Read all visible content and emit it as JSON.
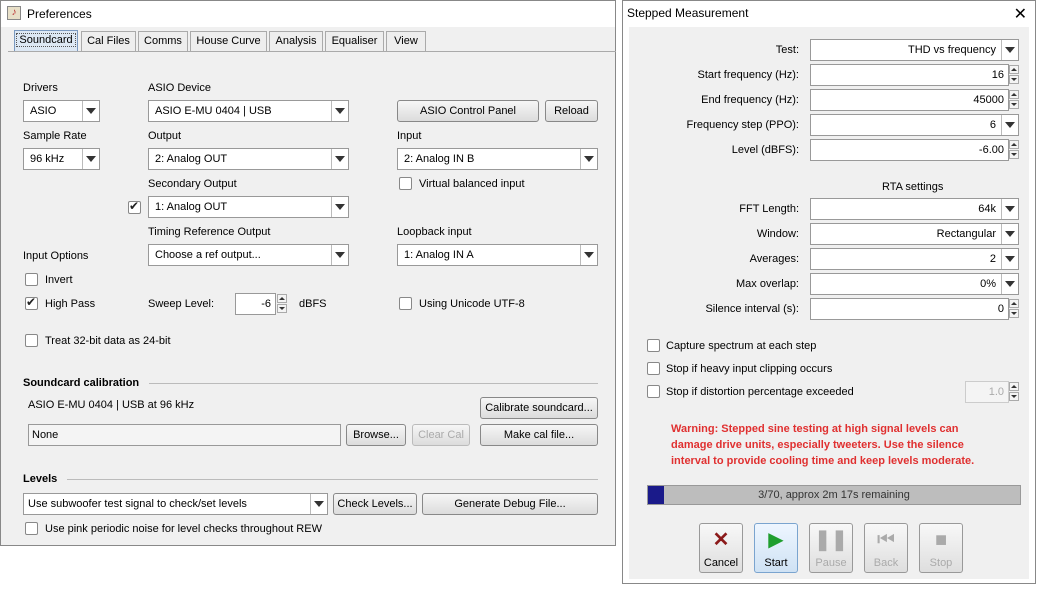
{
  "preferences": {
    "title": "Preferences",
    "tabs": [
      "Soundcard",
      "Cal Files",
      "Comms",
      "House Curve",
      "Analysis",
      "Equaliser",
      "View"
    ],
    "drivers": {
      "label": "Drivers",
      "value": "ASIO"
    },
    "asio_device": {
      "label": "ASIO Device",
      "value": "ASIO E-MU 0404 | USB"
    },
    "asio_control_panel": "ASIO Control Panel",
    "reload": "Reload",
    "sample_rate": {
      "label": "Sample Rate",
      "value": "96 kHz"
    },
    "output": {
      "label": "Output",
      "value": "2: Analog OUT"
    },
    "input": {
      "label": "Input",
      "value": "2: Analog IN B"
    },
    "secondary_output": {
      "label": "Secondary Output",
      "value": "1: Analog OUT",
      "checked": true
    },
    "virtual_balanced": {
      "label": "Virtual balanced input",
      "checked": false
    },
    "timing_ref": {
      "label": "Timing Reference Output",
      "value": "Choose a ref output..."
    },
    "loopback": {
      "label": "Loopback input",
      "value": "1: Analog IN A"
    },
    "input_options": "Input Options",
    "invert": {
      "label": "Invert",
      "checked": false
    },
    "high_pass": {
      "label": "High Pass",
      "checked": true
    },
    "sweep_level": {
      "label": "Sweep Level:",
      "value": "-6",
      "unit": "dBFS"
    },
    "unicode": {
      "label": "Using Unicode UTF-8",
      "checked": false
    },
    "treat_32bit": {
      "label": "Treat 32-bit data as 24-bit",
      "checked": false
    },
    "calibration": {
      "heading": "Soundcard calibration",
      "info": "ASIO E-MU 0404 | USB at 96 kHz",
      "calibrate_btn": "Calibrate soundcard...",
      "file_value": "None",
      "browse_btn": "Browse...",
      "clear_btn": "Clear Cal",
      "make_btn": "Make cal file..."
    },
    "levels": {
      "heading": "Levels",
      "signal_value": "Use subwoofer test signal to check/set levels",
      "check_btn": "Check Levels...",
      "debug_btn": "Generate Debug File...",
      "pink_noise": {
        "label": "Use pink periodic noise for level checks throughout REW",
        "checked": false
      }
    }
  },
  "stepped": {
    "title": "Stepped Measurement",
    "fields": [
      {
        "label": "Test:",
        "value": "THD vs frequency",
        "kind": "combo"
      },
      {
        "label": "Start frequency (Hz):",
        "value": "16",
        "kind": "spin"
      },
      {
        "label": "End frequency (Hz):",
        "value": "45000",
        "kind": "spin"
      },
      {
        "label": "Frequency step (PPO):",
        "value": "6",
        "kind": "combo"
      },
      {
        "label": "Level (dBFS):",
        "value": "-6.00",
        "kind": "spin"
      }
    ],
    "rta_heading": "RTA settings",
    "rta_fields": [
      {
        "label": "FFT Length:",
        "value": "64k",
        "kind": "combo"
      },
      {
        "label": "Window:",
        "value": "Rectangular",
        "kind": "combo"
      },
      {
        "label": "Averages:",
        "value": "2",
        "kind": "combo"
      },
      {
        "label": "Max overlap:",
        "value": "0%",
        "kind": "combo"
      },
      {
        "label": "Silence interval (s):",
        "value": "0",
        "kind": "spin"
      }
    ],
    "capture_spectrum": {
      "label": "Capture spectrum at each step",
      "checked": false
    },
    "stop_clipping": {
      "label": "Stop if heavy input clipping occurs",
      "checked": false
    },
    "stop_distortion": {
      "label": "Stop if distortion percentage exceeded",
      "checked": false,
      "value": "1.0"
    },
    "warning": "Warning: Stepped sine testing at high signal levels can damage drive units, especially tweeters. Use the silence interval to provide cooling time and keep levels moderate.",
    "progress": {
      "text": "3/70, approx 2m 17s remaining",
      "fraction": 0.043
    },
    "buttons": {
      "cancel": "Cancel",
      "start": "Start",
      "pause": "Pause",
      "back": "Back",
      "stop": "Stop"
    },
    "colors": {
      "warning": "#e03030",
      "progress_fill": "#1a1a8a",
      "cancel_icon": "#8b1a1a",
      "start_icon": "#1f9e2e"
    }
  }
}
